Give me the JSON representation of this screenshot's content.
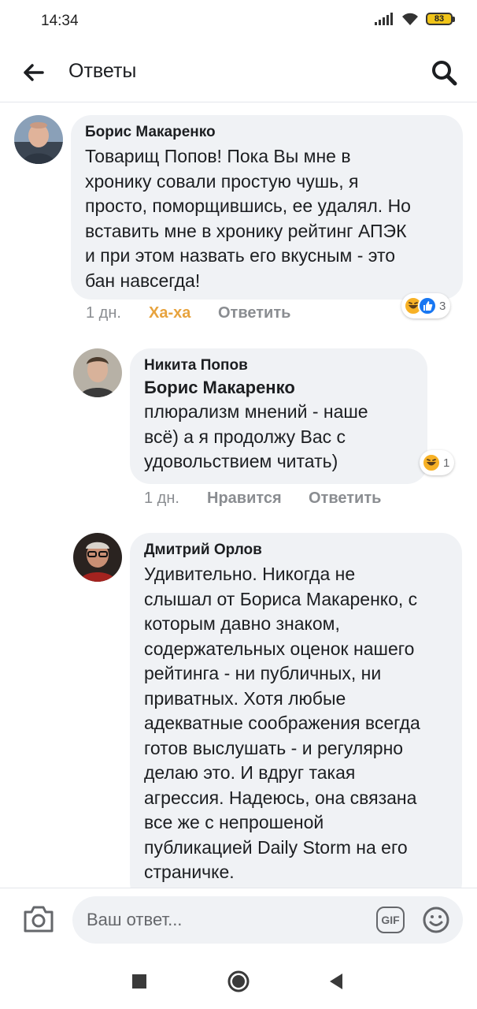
{
  "status_bar": {
    "time": "14:34",
    "battery": "83"
  },
  "header": {
    "title": "Ответы"
  },
  "comments": [
    {
      "author": "Борис Макаренко",
      "text": "Товарищ Попов! Пока Вы мне в\nхронику совали простую чушь, я\nпросто, поморщившись, ее удалял. Но\nвставить мне в хронику рейтинг АПЭК\nи при этом назвать его вкусным - это\nбан навсегда!",
      "time": "1 дн.",
      "reaction_label": "Ха-ха",
      "reply_label": "Ответить",
      "reaction_count": "3"
    },
    {
      "author": "Никита Попов",
      "mention": "Борис Макаренко",
      "text": "плюрализм мнений - наше\nвсё) а я продолжу Вас с\nудовольствием читать)",
      "time": "1 дн.",
      "like_label": "Нравится",
      "reply_label": "Ответить",
      "reaction_count": "1"
    },
    {
      "author": "Дмитрий Орлов",
      "text": "Удивительно. Никогда не\nслышал от Бориса Макаренко, с\nкоторым давно знаком,\nсодержательных оценок нашего\nрейтинга - ни публичных, ни\nприватных. Хотя любые\nадекватные соображения всегда\nготов выслушать - и регулярно\nделаю это. И вдруг такая\nагрессия. Надеюсь, она связана\nвсе же с непрошеной\nпубликацией Daily Storm на его\nстраничке."
    }
  ],
  "composer": {
    "placeholder": "Ваш ответ...",
    "gif_label": "GIF"
  },
  "colors": {
    "haha": "#e7a33e",
    "bubble": "#f0f2f5",
    "meta": "#8a8d91",
    "like_blue": "#1877f2"
  },
  "icons": [
    "back-arrow-icon",
    "search-icon",
    "camera-icon",
    "gif-icon",
    "smiley-icon",
    "haha-emoji-icon",
    "like-icon",
    "square-nav-icon",
    "home-circle-icon",
    "back-triangle-icon"
  ]
}
